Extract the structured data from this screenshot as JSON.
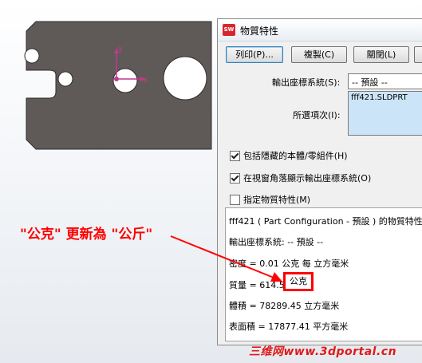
{
  "window": {
    "title": "物質特性",
    "app_icon": "SW"
  },
  "toolbar": {
    "print_label": "列印(P)...",
    "copy_label": "複製(C)",
    "close_label": "關閉(L)"
  },
  "options": {
    "output_coord_label": "輸出座標系統(S):",
    "output_coord_value": "-- 預設 --",
    "selected_items_label": "所選項次(I):",
    "selected_item": "fff421.SLDPRT",
    "include_hidden_label": "包括隱藏的本體/零組件(H)",
    "show_coord_label": "在視窗角落顯示輸出座標系統(O)",
    "assign_props_label": "指定物質特性(M)"
  },
  "results": {
    "header": "fff421 ( Part Configuration - 預設 ) 的物質特性",
    "coord_line": "輸出座標系統: -- 預設 --",
    "density_line": "密度 = 0.01 公克 每 立方毫米",
    "mass_line": "質量 = 614.57",
    "mass_unit": "公克",
    "volume_line": "體積 = 78289.45 立方毫米",
    "area_line": "表面積 = 17877.41 平方毫米"
  },
  "viewport": {
    "axis_y": "y",
    "axis_x": "x"
  },
  "annotation": {
    "text": "\"公克\" 更新為 \"公斤\""
  },
  "watermark": {
    "text": "三维网www.3dportal.cn"
  },
  "colors": {
    "part_face": "#5f5a58",
    "annotation": "#ff0000",
    "selection": "#cce4f7",
    "origin": "#c0398e"
  }
}
